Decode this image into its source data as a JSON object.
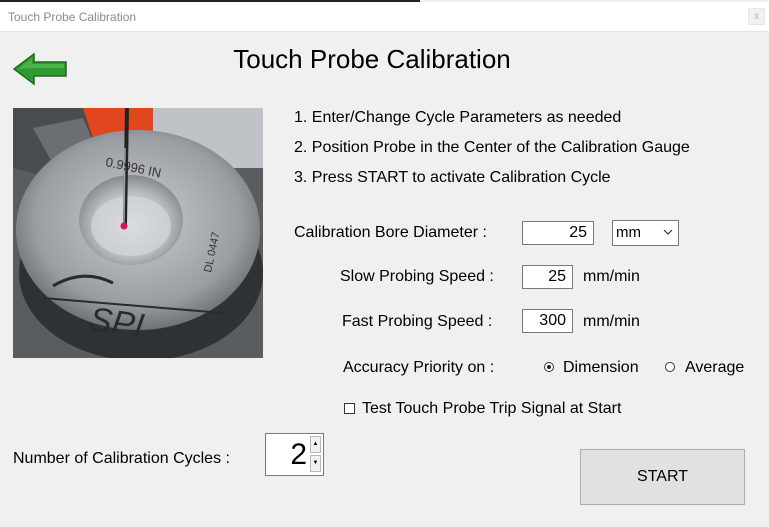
{
  "window": {
    "title": "Touch Probe Calibration",
    "close_glyph": "x"
  },
  "page": {
    "title": "Touch Probe Calibration"
  },
  "instructions": [
    "1. Enter/Change Cycle Parameters as needed",
    "2. Position Probe in the Center of the Calibration Gauge",
    "3. Press START to activate Calibration Cycle"
  ],
  "gauge": {
    "engraving_size": "0.9996 IN",
    "engraving_code": "DL 0447",
    "logo_text": "SPI"
  },
  "bore": {
    "label": "Calibration Bore Diameter :",
    "value": "25",
    "unit": "mm"
  },
  "slow_speed": {
    "label": "Slow Probing Speed :",
    "value": "25",
    "unit": "mm/min"
  },
  "fast_speed": {
    "label": "Fast Probing Speed :",
    "value": "300",
    "unit": "mm/min"
  },
  "accuracy": {
    "label": "Accuracy Priority on :",
    "options": [
      "Dimension",
      "Average"
    ],
    "selected": "Dimension"
  },
  "trip_signal": {
    "label": "Test Touch Probe Trip Signal at Start",
    "checked": false
  },
  "cycles": {
    "label": "Number of Calibration Cycles :",
    "value": "2",
    "up_glyph": "▲",
    "down_glyph": "▼"
  },
  "start": {
    "label": "START"
  },
  "colors": {
    "arrow_green": "#2f9a2f",
    "background": "#f0f0f0",
    "field_border": "#7a7a7a"
  },
  "icons": {
    "back": "arrow-left",
    "dropdown": "chevron-down"
  }
}
